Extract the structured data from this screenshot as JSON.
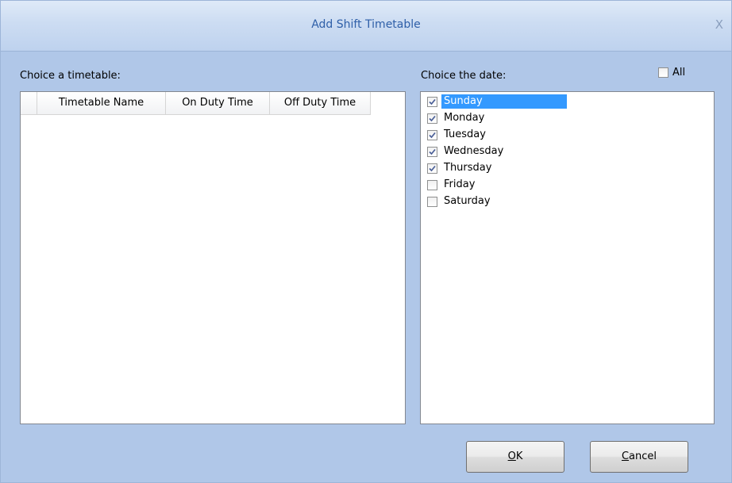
{
  "window": {
    "title": "Add Shift Timetable",
    "close_label": "X"
  },
  "timetable": {
    "label": "Choice a timetable:",
    "columns": [
      "Timetable Name",
      "On Duty Time",
      "Off Duty Time"
    ],
    "rows": []
  },
  "dates": {
    "label": "Choice the date:",
    "all_label": "All",
    "all_checked": false,
    "items": [
      {
        "label": "Sunday",
        "checked": true,
        "selected": true
      },
      {
        "label": "Monday",
        "checked": true,
        "selected": false
      },
      {
        "label": "Tuesday",
        "checked": true,
        "selected": false
      },
      {
        "label": "Wednesday",
        "checked": true,
        "selected": false
      },
      {
        "label": "Thursday",
        "checked": true,
        "selected": false
      },
      {
        "label": "Friday",
        "checked": false,
        "selected": false
      },
      {
        "label": "Saturday",
        "checked": false,
        "selected": false
      }
    ]
  },
  "buttons": {
    "ok_mnemonic": "O",
    "ok_rest": "K",
    "cancel_mnemonic": "C",
    "cancel_rest": "ancel"
  },
  "colors": {
    "title_text": "#2e5fa8",
    "dialog_bg": "#b0c7e8",
    "selection": "#3399ff",
    "check_mark": "#4a5f97"
  }
}
